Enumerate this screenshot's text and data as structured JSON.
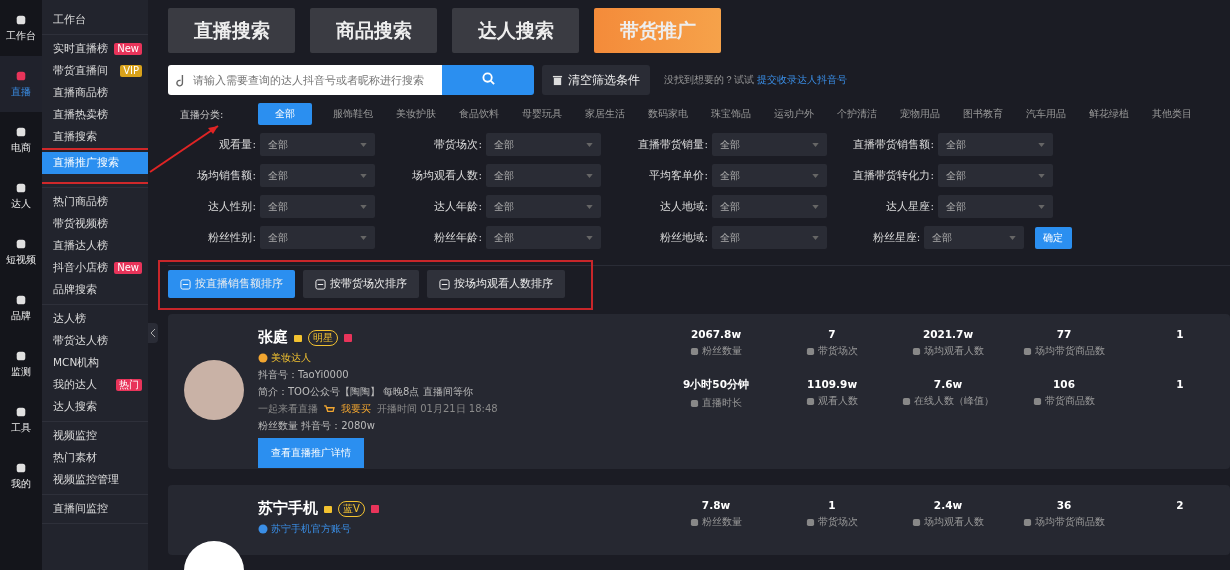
{
  "rail": [
    {
      "label": "工作台",
      "selected": false
    },
    {
      "label": "直播",
      "selected": true
    },
    {
      "label": "电商",
      "selected": false
    },
    {
      "label": "达人",
      "selected": false
    },
    {
      "label": "短视频",
      "selected": false
    },
    {
      "label": "品牌",
      "selected": false
    },
    {
      "label": "监测",
      "selected": false
    },
    {
      "label": "工具",
      "selected": false
    },
    {
      "label": "我的",
      "selected": false
    }
  ],
  "submenu": [
    {
      "items": [
        {
          "label": "工作台",
          "selected": false
        }
      ]
    },
    {
      "items": [
        {
          "label": "实时直播榜",
          "selected": false,
          "badge": "New",
          "color": "#e8345a"
        },
        {
          "label": "带货直播间",
          "selected": false,
          "badge": "VIP",
          "color": "#d9a21b"
        },
        {
          "label": "直播商品榜",
          "selected": false
        },
        {
          "label": "直播热卖榜",
          "selected": false
        },
        {
          "label": "直播搜索",
          "selected": false
        },
        {
          "label": "直播推广搜索",
          "selected": true
        }
      ]
    },
    {
      "items": [
        {
          "label": "热门商品榜",
          "selected": false
        },
        {
          "label": "带货视频榜",
          "selected": false
        },
        {
          "label": "直播达人榜",
          "selected": false
        },
        {
          "label": "抖音小店榜",
          "selected": false,
          "badge": "New",
          "color": "#e8345a"
        },
        {
          "label": "品牌搜索",
          "selected": false
        }
      ]
    },
    {
      "items": [
        {
          "label": "达人榜",
          "selected": false
        },
        {
          "label": "带货达人榜",
          "selected": false
        },
        {
          "label": "MCN机构",
          "selected": false
        },
        {
          "label": "我的达人",
          "selected": false,
          "badge": "热门",
          "color": "#e8345a"
        },
        {
          "label": "达人搜索",
          "selected": false
        }
      ]
    },
    {
      "items": [
        {
          "label": "视频监控",
          "selected": false
        },
        {
          "label": "热门素材",
          "selected": false
        },
        {
          "label": "视频监控管理",
          "selected": false
        }
      ]
    },
    {
      "items": [
        {
          "label": "直播间监控",
          "selected": false
        }
      ]
    }
  ],
  "search_tabs": [
    {
      "label": "直播搜索",
      "selected": false
    },
    {
      "label": "商品搜索",
      "selected": false
    },
    {
      "label": "达人搜索",
      "selected": false
    },
    {
      "label": "带货推广",
      "selected": true
    }
  ],
  "search": {
    "placeholder": "请输入需要查询的达人抖音号或者昵称进行搜索",
    "clear_button": "清空筛选条件",
    "hint": "没找到想要的？试试",
    "hint_link": "提交收录达人抖音号"
  },
  "category": {
    "label": "直播分类:",
    "options": [
      {
        "label": "全部",
        "selected": true
      },
      {
        "label": "服饰鞋包",
        "selected": false
      },
      {
        "label": "美妆护肤",
        "selected": false
      },
      {
        "label": "食品饮料",
        "selected": false
      },
      {
        "label": "母婴玩具",
        "selected": false
      },
      {
        "label": "家居生活",
        "selected": false
      },
      {
        "label": "数码家电",
        "selected": false
      },
      {
        "label": "珠宝饰品",
        "selected": false
      },
      {
        "label": "运动户外",
        "selected": false
      },
      {
        "label": "个护清洁",
        "selected": false
      },
      {
        "label": "宠物用品",
        "selected": false
      },
      {
        "label": "图书教育",
        "selected": false
      },
      {
        "label": "汽车用品",
        "selected": false
      },
      {
        "label": "鲜花绿植",
        "selected": false
      },
      {
        "label": "其他类目",
        "selected": false
      }
    ]
  },
  "filters": [
    {
      "label": "观看量:",
      "value": "全部"
    },
    {
      "label": "带货场次:",
      "value": "全部"
    },
    {
      "label": "直播带货销量:",
      "value": "全部"
    },
    {
      "label": "直播带货销售额:",
      "value": "全部"
    },
    {
      "label": "场均销售额:",
      "value": "全部"
    },
    {
      "label": "场均观看人数:",
      "value": "全部"
    },
    {
      "label": "平均客单价:",
      "value": "全部"
    },
    {
      "label": "直播带货转化力:",
      "value": "全部"
    },
    {
      "label": "达人性别:",
      "value": "全部"
    },
    {
      "label": "达人年龄:",
      "value": "全部"
    },
    {
      "label": "达人地域:",
      "value": "全部"
    },
    {
      "label": "达人星座:",
      "value": "全部"
    },
    {
      "label": "粉丝性别:",
      "value": "全部"
    },
    {
      "label": "粉丝年龄:",
      "value": "全部"
    },
    {
      "label": "粉丝地域:",
      "value": "全部"
    },
    {
      "label": "粉丝星座:",
      "value": "全部"
    }
  ],
  "confirm_button": "确定",
  "sort_buttons": [
    {
      "label": "按直播销售额排序",
      "selected": true
    },
    {
      "label": "按带货场次排序",
      "selected": false
    },
    {
      "label": "按场均观看人数排序",
      "selected": false
    }
  ],
  "results": [
    {
      "name": "张庭",
      "tag": "明星",
      "verify": "美妆达人",
      "lines": [
        "抖音号：TaoYi0000",
        "简介：TOO公众号【陶陶】 每晚8点 直播间等你"
      ],
      "live_title": "一起来看直播",
      "shop": "我要买",
      "live_time": "开播时间 01月21日 18:48",
      "stats": [
        {
          "value": "2067.8w",
          "label": "粉丝数量"
        },
        {
          "value": "7",
          "label": "带货场次"
        },
        {
          "value": "2021.7w",
          "label": "场均观看人数"
        },
        {
          "value": "77",
          "label": "场均带货商品数"
        },
        {
          "value": "1"
        },
        {
          "value": "9小时50分钟",
          "label": "直播时长"
        },
        {
          "value": "1109.9w",
          "label": "观看人数"
        },
        {
          "value": "7.6w",
          "label": "在线人数（峰值）"
        },
        {
          "value": "106",
          "label": "带货商品数"
        },
        {
          "value": "1"
        }
      ],
      "extra": "粉丝数量 抖音号：2080w",
      "button": "查看直播推广详情"
    },
    {
      "name": "苏宁手机",
      "tag": "蓝V",
      "verify": "苏宁手机官方账号",
      "stats": [
        {
          "value": "7.8w",
          "label": "粉丝数量"
        },
        {
          "value": "1",
          "label": "带货场次"
        },
        {
          "value": "2.4w",
          "label": "场均观看人数"
        },
        {
          "value": "36",
          "label": "场均带货商品数"
        },
        {
          "value": "2"
        }
      ]
    }
  ]
}
